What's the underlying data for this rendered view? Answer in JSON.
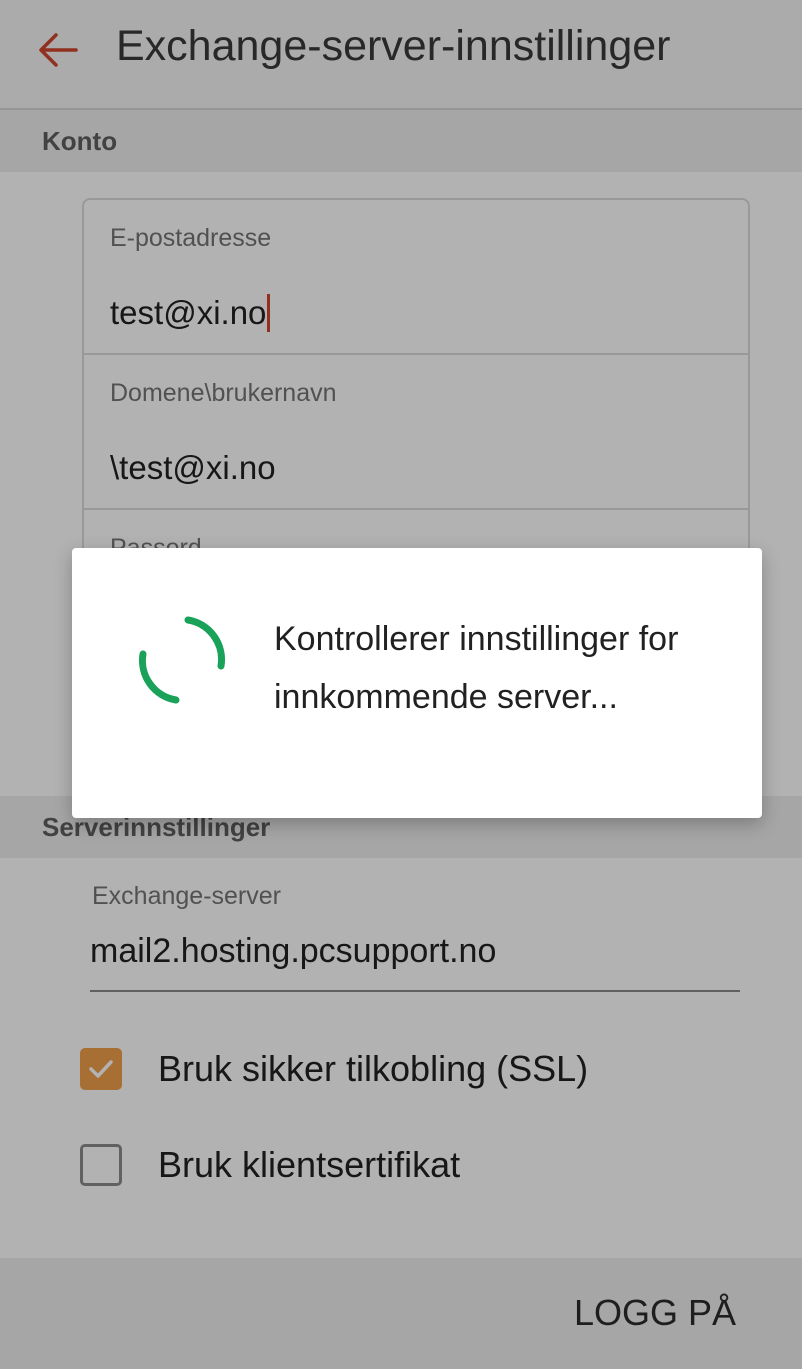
{
  "appbar": {
    "title": "Exchange-server-innstillinger"
  },
  "account_section": {
    "header": "Konto",
    "fields": [
      {
        "label": "E-postadresse",
        "value": "test@xi.no"
      },
      {
        "label": "Domene\\brukernavn",
        "value": "\\test@xi.no"
      },
      {
        "label": "Passord",
        "value": ""
      }
    ]
  },
  "server_section": {
    "header": "Serverinnstillinger",
    "exchange_label": "Exchange-server",
    "exchange_value": "mail2.hosting.pcsupport.no",
    "ssl_label": "Bruk sikker tilkobling (SSL)",
    "ssl_checked": true,
    "client_cert_label": "Bruk klientsertifikat",
    "client_cert_checked": false
  },
  "bottom_bar": {
    "login_label": "LOGG PÅ"
  },
  "dialog": {
    "message": "Kontrollerer innstillinger for innkommende server..."
  },
  "colors": {
    "accent": "#d2452f",
    "checkbox": "#f0a04b",
    "spinner": "#1aa25a"
  }
}
